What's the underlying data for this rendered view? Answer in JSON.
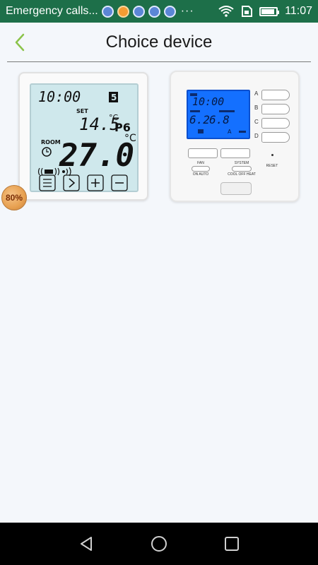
{
  "status_bar": {
    "notification_text": "Emergency calls...",
    "overflow": "···",
    "time": "11:07"
  },
  "header": {
    "title": "Choice device"
  },
  "devices": [
    {
      "lcd": {
        "time": "10:00",
        "day": "5",
        "set_label": "SET",
        "set_temp": "14.5",
        "set_unit": "°C",
        "program": "P6",
        "room_label": "ROOM",
        "room_temp": "27.0",
        "room_unit": "°C"
      }
    },
    {
      "lcd": {
        "time": "10:00",
        "left_value": "6.2",
        "right_value": "6.8",
        "mode_letter": "A"
      },
      "side_buttons": [
        "A",
        "B",
        "C",
        "D"
      ],
      "labels": {
        "fan": "FAN",
        "fan_modes": "ON AUTO",
        "system": "SYSTEM",
        "system_modes": "COOL OFF HEAT",
        "reset": "RESET"
      }
    }
  ],
  "overlay": {
    "percent": "80%"
  }
}
